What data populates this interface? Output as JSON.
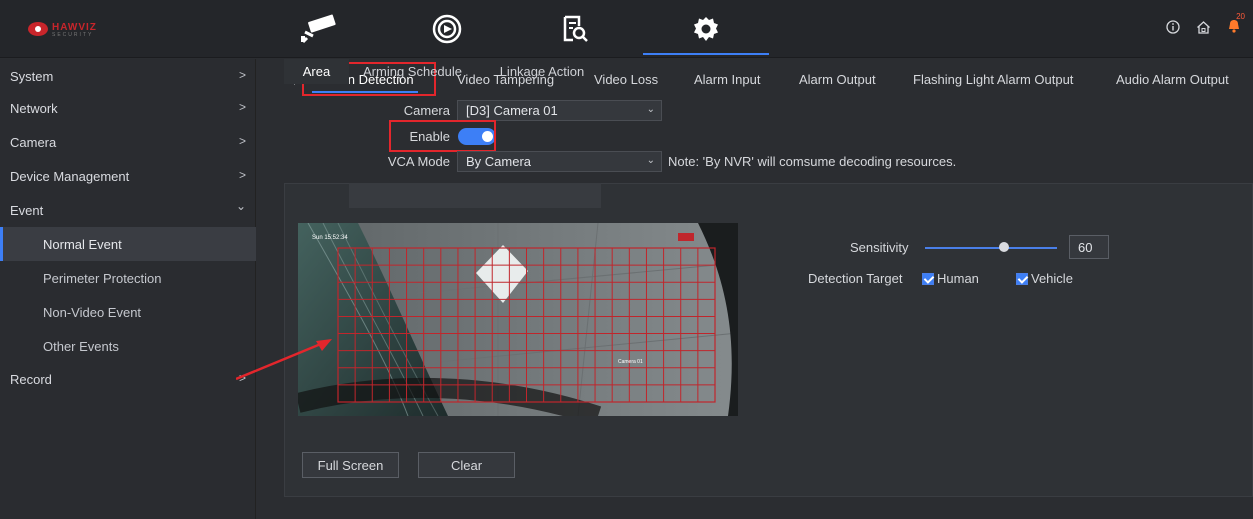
{
  "brand": {
    "logo_text": "HAWVIZ",
    "logo_sub": "SECURITY"
  },
  "topnav": {
    "items": [
      {
        "name": "live-view",
        "icon": "camera-icon"
      },
      {
        "name": "playback",
        "icon": "playback-icon"
      },
      {
        "name": "search",
        "icon": "file-search-icon"
      },
      {
        "name": "configuration",
        "icon": "gear-icon",
        "active": true
      }
    ],
    "right_icons": [
      "info-icon",
      "home-icon",
      "bell-icon"
    ],
    "bell_count": "20"
  },
  "sidebar": {
    "items": [
      {
        "label": "System",
        "arrow": ">"
      },
      {
        "label": "Network",
        "arrow": ">"
      },
      {
        "label": "Camera",
        "arrow": ">"
      },
      {
        "label": "Device Management",
        "arrow": ">"
      },
      {
        "label": "Event",
        "arrow": "⌄"
      },
      {
        "label": "Normal Event",
        "sub": true,
        "active": true
      },
      {
        "label": "Perimeter Protection",
        "sub": true
      },
      {
        "label": "Non-Video Event",
        "sub": true
      },
      {
        "label": "Other Events",
        "sub": true
      },
      {
        "label": "Record",
        "arrow": ">"
      }
    ]
  },
  "tabs": [
    "Motion Detection",
    "Video Tampering",
    "Video Loss",
    "Alarm Input",
    "Alarm Output",
    "Flashing Light Alarm Output",
    "Audio Alarm Output"
  ],
  "form": {
    "camera_label": "Camera",
    "camera_value": "[D3] Camera 01",
    "enable_label": "Enable",
    "enable_on": true,
    "vca_label": "VCA Mode",
    "vca_value": "By Camera",
    "note": "Note: 'By NVR' will comsume decoding resources."
  },
  "subtabs": [
    "Area",
    "Arming Schedule",
    "Linkage Action"
  ],
  "video": {
    "timestamp": "Sun 15:52:34",
    "camera_overlay": "Camera 01"
  },
  "settings": {
    "sensitivity_label": "Sensitivity",
    "sensitivity_value": "60",
    "detection_label": "Detection Target",
    "targets": [
      {
        "label": "Human",
        "checked": true
      },
      {
        "label": "Vehicle",
        "checked": true
      }
    ]
  },
  "buttons": {
    "full_screen": "Full Screen",
    "clear": "Clear"
  },
  "colors": {
    "accent": "#3d7ff6",
    "highlight_box": "#e3262c",
    "grid": "#c0262c"
  }
}
